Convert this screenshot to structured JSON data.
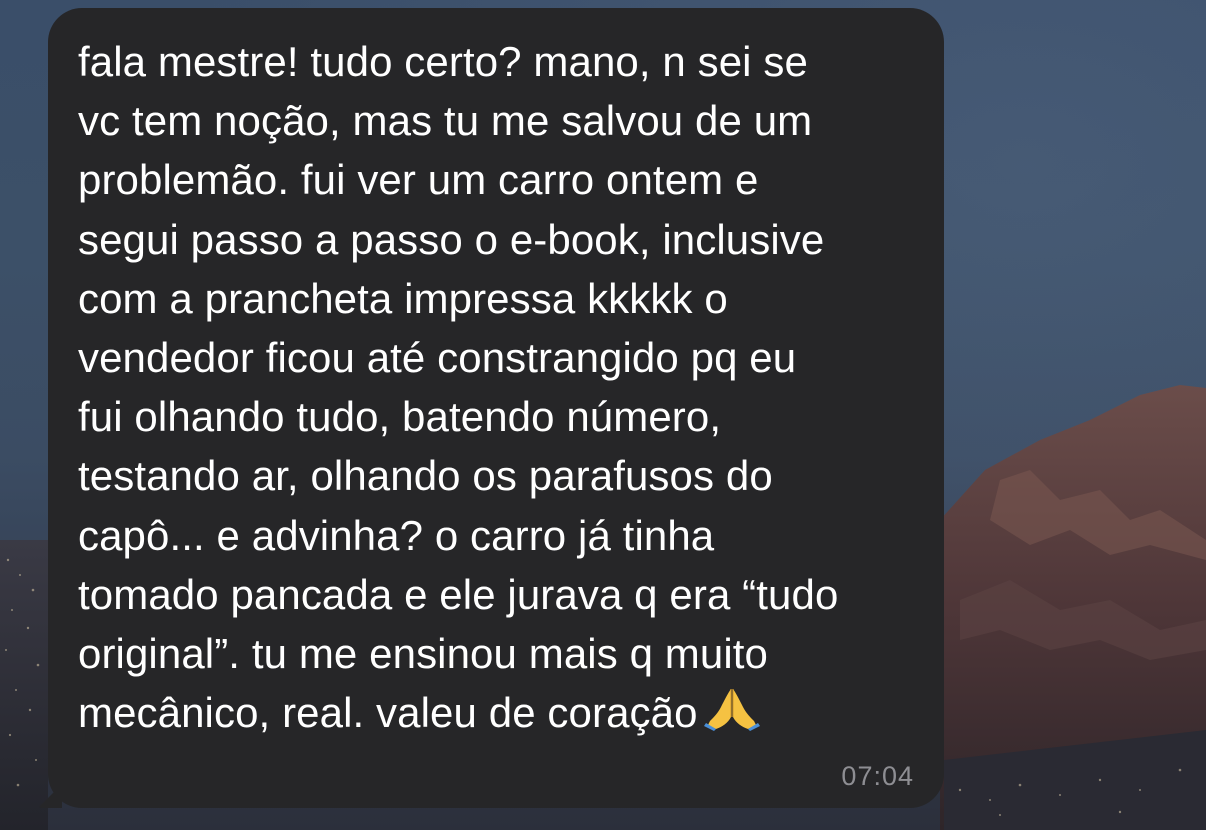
{
  "message": {
    "lines": [
      "fala mestre! tudo certo? mano, n sei se",
      "vc tem noção, mas tu me salvou de um",
      "problemão. fui ver um carro ontem e",
      "segui passo a passo o e-book, inclusive",
      "com a prancheta impressa kkkkk o",
      "vendedor ficou até constrangido pq eu",
      "fui olhando tudo, batendo número,",
      "testando ar, olhando os parafusos do",
      "capô... e advinha? o carro já tinha",
      "tomado pancada e ele jurava q era “tudo",
      "original”. tu me ensinou mais q muito",
      "mecânico, real. valeu de coração"
    ],
    "emoji": "folded-hands-icon",
    "time": "07:04"
  },
  "colors": {
    "bubble": "#262628",
    "text": "#ffffff",
    "timestamp": "#8e8e93"
  }
}
